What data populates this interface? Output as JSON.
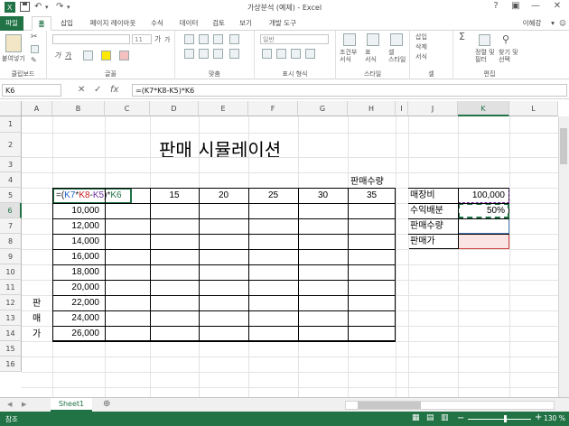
{
  "window": {
    "title": "가상분석 (예제) - Excel",
    "user": "이혜강",
    "help": "?",
    "minimize": "—",
    "restore": "□",
    "close": "✕",
    "account_arrow": "▾",
    "ribbon_display": "▣"
  },
  "qat": {
    "save_icon": "save-icon",
    "undo_icon": "undo-icon",
    "redo_icon": "redo-icon"
  },
  "tabs": [
    "파일",
    "홈",
    "삽입",
    "페이지 레이아웃",
    "수식",
    "데이터",
    "검토",
    "보기",
    "개발 도구"
  ],
  "ribbon": {
    "clipboard": {
      "label": "클립보드",
      "paste": "붙여넣기"
    },
    "font": {
      "label": "글꼴",
      "size": "11",
      "italic": "가",
      "underline": "가",
      "grow": "가",
      "shrink": "가"
    },
    "alignment": {
      "label": "맞춤"
    },
    "number": {
      "label": "표시 형식",
      "format": "일반"
    },
    "styles": {
      "label": "스타일",
      "cond": "조건부\n서식",
      "table": "표\n서식",
      "cell": "셀\n스타일"
    },
    "cells": {
      "label": "셀",
      "insert": "삽입",
      "delete": "삭제",
      "format": "서식"
    },
    "editing": {
      "label": "편집",
      "sort": "정렬 및\n필터",
      "find": "찾기 및\n선택",
      "sum_icon": "Σ"
    }
  },
  "formula_bar": {
    "name_box": "K6",
    "formula": "=(K7*K8-K5)*K6",
    "cancel": "✕",
    "enter": "✓",
    "fx": "fx"
  },
  "columns": [
    "A",
    "B",
    "C",
    "D",
    "E",
    "F",
    "G",
    "H",
    "I",
    "J",
    "K",
    "L"
  ],
  "rows": [
    "1",
    "2",
    "3",
    "4",
    "5",
    "6",
    "7",
    "8",
    "9",
    "10",
    "11",
    "12",
    "13",
    "14",
    "15",
    "16"
  ],
  "sheet": {
    "title": "판매 시뮬레이션",
    "qty_label": "판매수량",
    "editing_formula": {
      "open": "=(",
      "k7": "K7",
      "mul": "*",
      "k8": "K8",
      "minus": "-",
      "k5": "K5",
      "close": ")*",
      "k6": "K6"
    },
    "qty_headers": [
      "15",
      "20",
      "25",
      "30",
      "35"
    ],
    "prices": [
      "10,000",
      "12,000",
      "14,000",
      "16,000",
      "18,000",
      "20,000",
      "22,000",
      "24,000",
      "26,000"
    ],
    "side_label": [
      "판",
      "매",
      "가"
    ],
    "inputs": [
      {
        "label": "매장비",
        "value": "100,000"
      },
      {
        "label": "수익배분",
        "value": "50%"
      },
      {
        "label": "판매수량",
        "value": ""
      },
      {
        "label": "판매가",
        "value": ""
      }
    ]
  },
  "sheet_tabs": {
    "active": "Sheet1",
    "add": "⊕",
    "nav_prev": "◀",
    "nav_next": "▶"
  },
  "status": {
    "mode": "참조",
    "zoom": "130 %"
  }
}
